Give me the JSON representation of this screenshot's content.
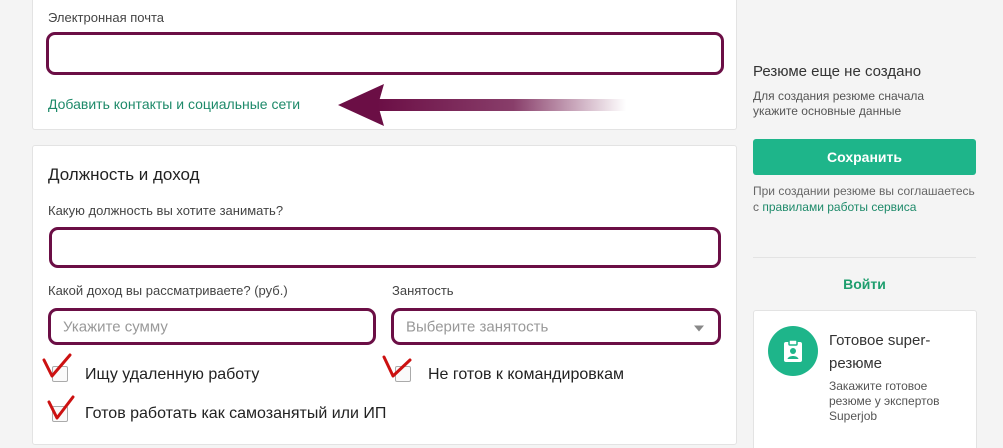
{
  "contacts": {
    "email_label": "Электронная почта",
    "email_value": "",
    "add_contacts_link": "Добавить контакты и социальные сети"
  },
  "position": {
    "title": "Должность и доход",
    "job_label": "Какую должность вы хотите занимать?",
    "job_value": "",
    "income_label": "Какой доход вы рассматриваете? (руб.)",
    "income_placeholder": "Укажите сумму",
    "employment_label": "Занятость",
    "employment_placeholder": "Выберите занятость",
    "checkboxes": {
      "remote": "Ищу удаленную работу",
      "no_trips": "Не готов к командировкам",
      "self_employed": "Готов работать как самозанятый или ИП"
    }
  },
  "sidebar": {
    "status_title": "Резюме еще не создано",
    "status_desc": "Для создания резюме сначала укажите основные данные",
    "save_label": "Сохранить",
    "terms_prefix": "При создании резюме вы соглашаетесь с ",
    "terms_link": "правилами работы сервиса",
    "login_label": "Войти",
    "promo": {
      "title": "Готовое super-резюме",
      "desc": "Закажите готовое резюме у экспертов Superjob"
    }
  },
  "colors": {
    "accent": "#1eb58a",
    "link": "#1e8a6a",
    "annotation": "#6b0e45",
    "annotation_tick": "#cc1111"
  },
  "icons": {
    "arrow": "arrow-left-icon",
    "promo": "clipboard-person-icon",
    "dropdown": "chevron-down-icon",
    "tick": "checkmark-icon"
  }
}
